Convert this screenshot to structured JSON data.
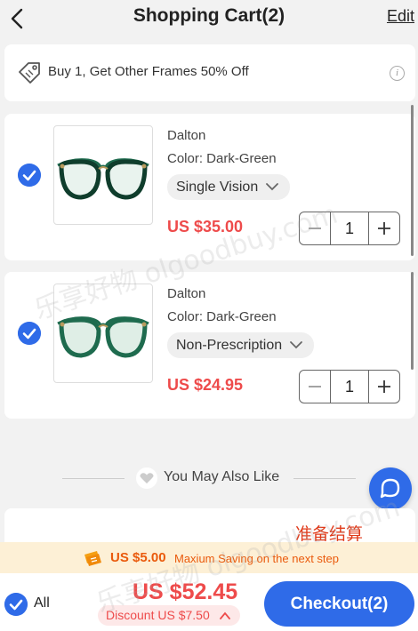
{
  "header": {
    "title": "Shopping Cart(2)",
    "edit_label": "Edit"
  },
  "promo": {
    "text": "Buy 1, Get Other Frames 50% Off",
    "info_icon": "i"
  },
  "cart_items": [
    {
      "name": "Dalton",
      "color": "Color: Dark-Green",
      "lens": "Single Vision",
      "price": "US $35.00",
      "qty": "1",
      "selected": true
    },
    {
      "name": "Dalton",
      "color": "Color: Dark-Green",
      "lens": "Non-Prescription",
      "price": "US $24.95",
      "qty": "1",
      "selected": true
    }
  ],
  "recommend": {
    "title": "You May Also Like"
  },
  "overlay_text": "准备结算",
  "watermark": [
    "乐享好物 olgoodbuy.com",
    "乐享好物 olgoodbuy.com"
  ],
  "saving": {
    "amount": "US $5.00",
    "note": "Maxium Saving on the next step"
  },
  "footer": {
    "all_label": "All",
    "total": "US $52.45",
    "discount": "Discount US $7.50",
    "checkout_label": "Checkout(2)"
  },
  "colors": {
    "accent": "#2f6be8",
    "price": "#ee4b4b",
    "saving": "#ea5a0c",
    "frame": "#1e6b4e"
  }
}
